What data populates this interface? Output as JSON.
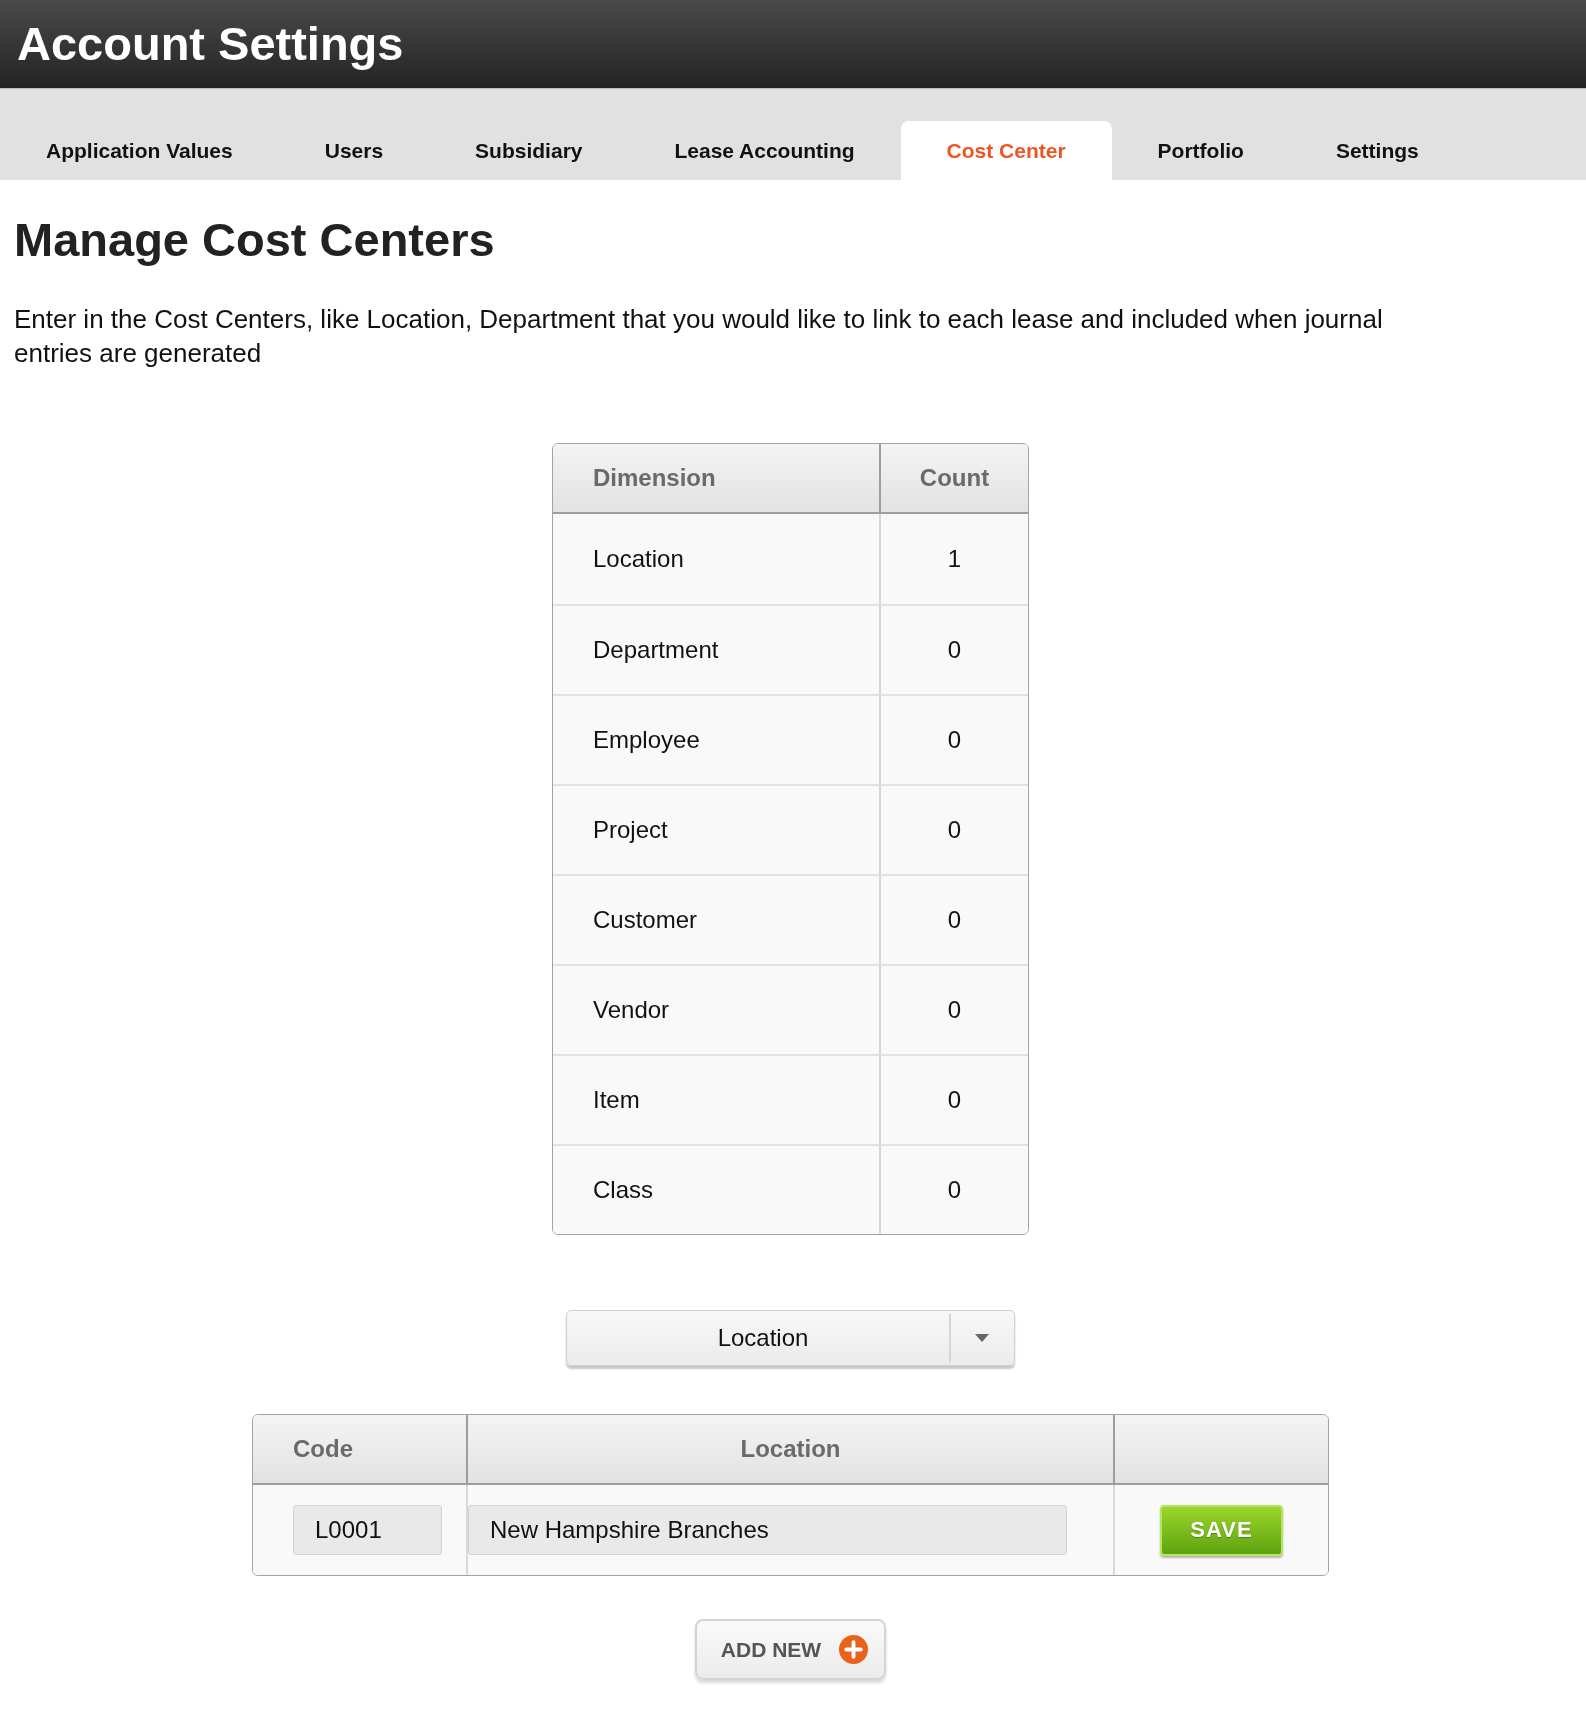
{
  "header": {
    "title": "Account Settings"
  },
  "tabs": [
    {
      "label": "Application Values",
      "selected": false
    },
    {
      "label": "Users",
      "selected": false
    },
    {
      "label": "Subsidiary",
      "selected": false
    },
    {
      "label": "Lease Accounting",
      "selected": false
    },
    {
      "label": "Cost Center",
      "selected": true
    },
    {
      "label": "Portfolio",
      "selected": false
    },
    {
      "label": "Settings",
      "selected": false
    }
  ],
  "page": {
    "heading": "Manage Cost Centers",
    "description": "Enter in the Cost Centers, like Location, Department that you would like to link to each lease and included when journal entries are generated"
  },
  "dimensions_table": {
    "columns": [
      "Dimension",
      "Count"
    ],
    "rows": [
      {
        "dimension": "Location",
        "count": "1"
      },
      {
        "dimension": "Department",
        "count": "0"
      },
      {
        "dimension": "Employee",
        "count": "0"
      },
      {
        "dimension": "Project",
        "count": "0"
      },
      {
        "dimension": "Customer",
        "count": "0"
      },
      {
        "dimension": "Vendor",
        "count": "0"
      },
      {
        "dimension": "Item",
        "count": "0"
      },
      {
        "dimension": "Class",
        "count": "0"
      }
    ]
  },
  "dimension_select": {
    "value": "Location"
  },
  "entries_table": {
    "columns": [
      "Code",
      "Location"
    ],
    "rows": [
      {
        "code": "L0001",
        "name": "New Hampshire Branches",
        "action": "SAVE"
      }
    ]
  },
  "add_button": {
    "label": "ADD NEW"
  }
}
